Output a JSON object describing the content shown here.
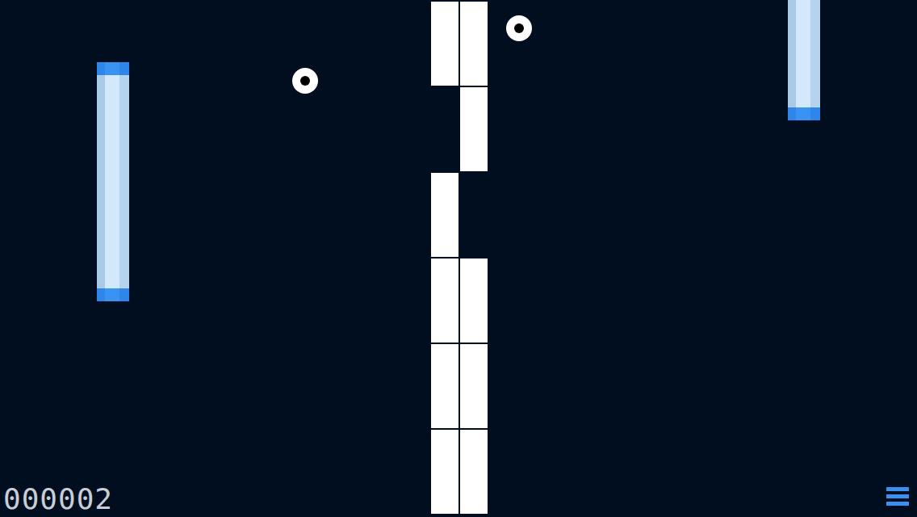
{
  "score": "000002",
  "wall": [
    {
      "left": true,
      "right": true
    },
    {
      "left": false,
      "right": true
    },
    {
      "left": true,
      "right": false
    },
    {
      "left": true,
      "right": true
    },
    {
      "left": true,
      "right": true
    },
    {
      "left": true,
      "right": true
    }
  ],
  "paddles": [
    {
      "side": "left",
      "capTop": true,
      "capBottom": true
    },
    {
      "side": "right",
      "capTop": false,
      "capBottom": true
    }
  ],
  "balls": [
    {
      "id": "a"
    },
    {
      "id": "b"
    }
  ]
}
